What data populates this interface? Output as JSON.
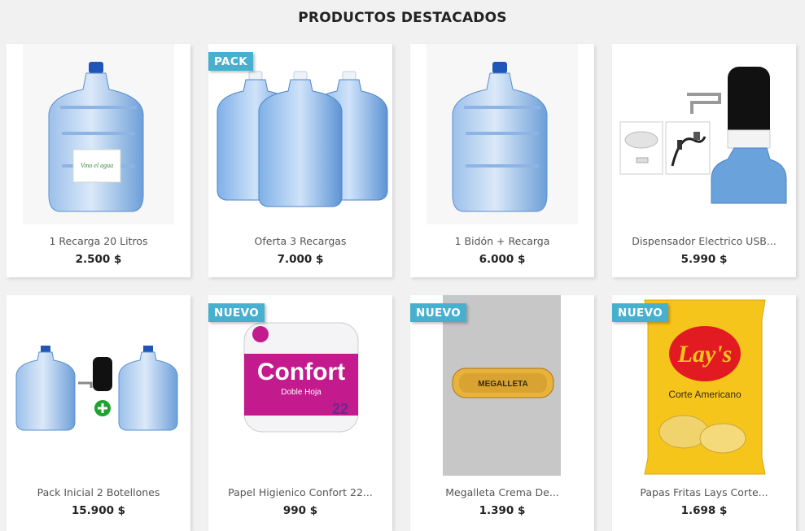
{
  "section": {
    "title": "PRODUCTOS DESTACADOS"
  },
  "products": [
    {
      "name": "1 Recarga 20 Litros",
      "price": "2.500 $",
      "badge": "",
      "image_icon": "water-jug-icon",
      "label_text": "Vino el agua"
    },
    {
      "name": "Oferta 3 Recargas",
      "price": "7.000 $",
      "badge": "PACK",
      "image_icon": "three-water-jugs-icon"
    },
    {
      "name": "1 Bidón + Recarga",
      "price": "6.000 $",
      "badge": "",
      "image_icon": "water-jug-icon"
    },
    {
      "name": "Dispensador Electrico USB...",
      "price": "5.990 $",
      "badge": "",
      "image_icon": "electric-dispenser-icon"
    },
    {
      "name": "Pack Inicial 2 Botellones",
      "price": "15.900 $",
      "badge": "",
      "image_icon": "two-jugs-plus-dispenser-icon"
    },
    {
      "name": "Papel Higienico Confort 22...",
      "price": "990 $",
      "badge": "NUEVO",
      "image_icon": "toilet-paper-icon",
      "brand_text": "Confort",
      "sub_text": "Doble Hoja",
      "count_text": "22"
    },
    {
      "name": "Megalleta Crema De...",
      "price": "1.390 $",
      "badge": "NUEVO",
      "image_icon": "cookie-pack-icon",
      "brand_text": "MEGALLETA"
    },
    {
      "name": "Papas Fritas Lays Corte...",
      "price": "1.698 $",
      "badge": "NUEVO",
      "image_icon": "chips-bag-icon",
      "brand_text": "Lay's",
      "sub_text": "Corte Americano"
    }
  ],
  "colors": {
    "badge": "#47b0cf",
    "jug": "#6fa3dc",
    "cap": "#1f56b8"
  }
}
